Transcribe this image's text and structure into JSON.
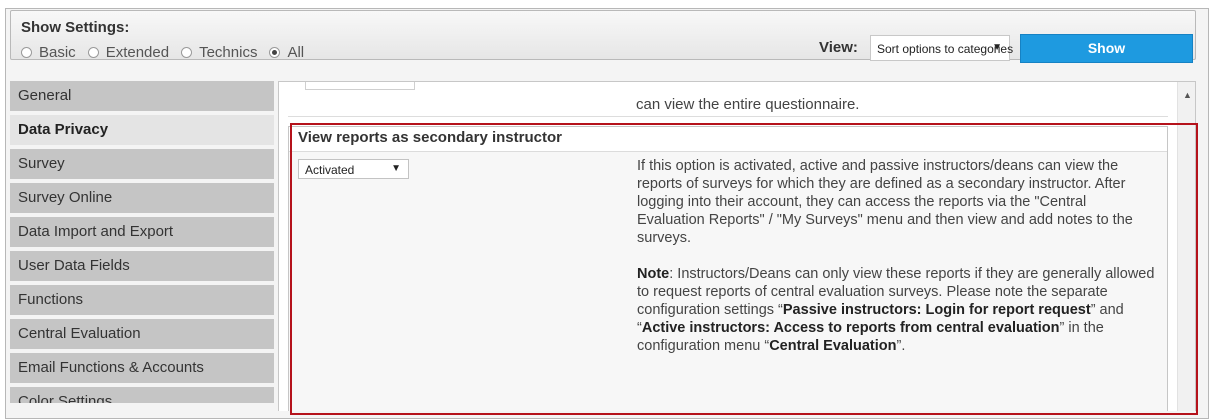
{
  "settings": {
    "title": "Show Settings:",
    "options": [
      {
        "label": "Basic",
        "checked": false
      },
      {
        "label": "Extended",
        "checked": false
      },
      {
        "label": "Technics",
        "checked": false
      },
      {
        "label": "All",
        "checked": true
      }
    ],
    "view_label": "View:",
    "view_value": "Sort options to categories",
    "show_button": "Show"
  },
  "sidebar": {
    "items": [
      {
        "label": "General",
        "active": false
      },
      {
        "label": "Data Privacy",
        "active": true
      },
      {
        "label": "Survey",
        "active": false
      },
      {
        "label": "Survey Online",
        "active": false
      },
      {
        "label": "Data Import and Export",
        "active": false
      },
      {
        "label": "User Data Fields",
        "active": false
      },
      {
        "label": "Functions",
        "active": false
      },
      {
        "label": "Central Evaluation",
        "active": false
      },
      {
        "label": "Email Functions & Accounts",
        "active": false
      },
      {
        "label": "Color Settings",
        "active": false
      }
    ]
  },
  "main": {
    "previous_text": "can view the entire questionnaire.",
    "section": {
      "title": "View reports as secondary instructor",
      "select_value": "Activated",
      "para1": "If this option is activated, active and passive instructors/deans can view the reports of surveys for which they are defined as a secondary instructor. After logging into their account, they can access the reports via the \"Central Evaluation Reports\" / \"My Surveys\" menu and then view and add notes to the surveys.",
      "note_label": "Note",
      "note_text_1": ": Instructors/Deans can only view these reports if they are generally allowed to request reports of central evaluation surveys. Please note the separate configuration settings “",
      "note_bold_1": "Passive instructors: Login for report request",
      "note_text_2": "” and “",
      "note_bold_2": "Active instructors: Access to reports from central evaluation",
      "note_text_3": "” in the configuration menu “",
      "note_bold_3": "Central Evaluation",
      "note_text_4": "”."
    }
  },
  "colors": {
    "accent": "#1e9ae0",
    "highlight": "#b5121b"
  }
}
